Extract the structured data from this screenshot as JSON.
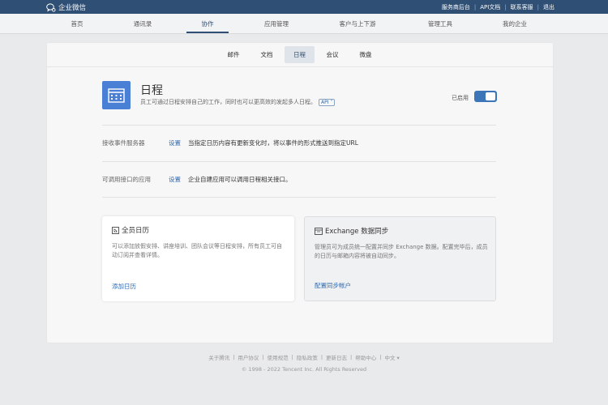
{
  "topbar": {
    "logo_text": "企业微信",
    "links": [
      "服务商后台",
      "API文档",
      "联系客服",
      "退出"
    ]
  },
  "nav": {
    "items": [
      "首页",
      "通讯录",
      "协作",
      "应用管理",
      "客户与上下游",
      "管理工具",
      "我的企业"
    ],
    "active_index": 2
  },
  "subtabs": {
    "items": [
      "邮件",
      "文档",
      "日程",
      "会议",
      "微盘"
    ],
    "active_index": 2
  },
  "app": {
    "title": "日程",
    "description": "员工可通过日程安排自己的工作，同时也可以更高效的发起多人日程。",
    "api_badge": "API",
    "status_label": "已启用",
    "enabled": true
  },
  "rows": [
    {
      "label": "接收事件服务器",
      "link": "设置",
      "desc": "当指定日历内容有更新变化时，将以事件的形式推送到指定URL"
    },
    {
      "label": "可调用接口的应用",
      "link": "设置",
      "desc": "企业自建应用可以调用日程相关接口。"
    }
  ],
  "cards": [
    {
      "title": "全员日历",
      "desc": "可以添加放假安排、讲座培训、团队会议等日程安排，所有员工可自动订阅并查看详情。",
      "link": "添加日历"
    },
    {
      "title": "Exchange 数据同步",
      "desc": "管理员可为成员统一配置并同步 Exchange 数据。配置完毕后，成员的日历与邮箱内容将被自动同步。",
      "link": "配置同步帐户"
    }
  ],
  "footer": {
    "links": [
      "关于腾讯",
      "用户协议",
      "使用规范",
      "隐私政策",
      "更新日志",
      "帮助中心",
      "中文 ▾"
    ],
    "copyright": "© 1998 - 2022 Tencent Inc. All Rights Reserved"
  },
  "colors": {
    "topbar": "#2f4f74",
    "accent": "#2f6ab0",
    "app_icon": "#4a7fd6",
    "toggle_on": "#3d75b9"
  }
}
